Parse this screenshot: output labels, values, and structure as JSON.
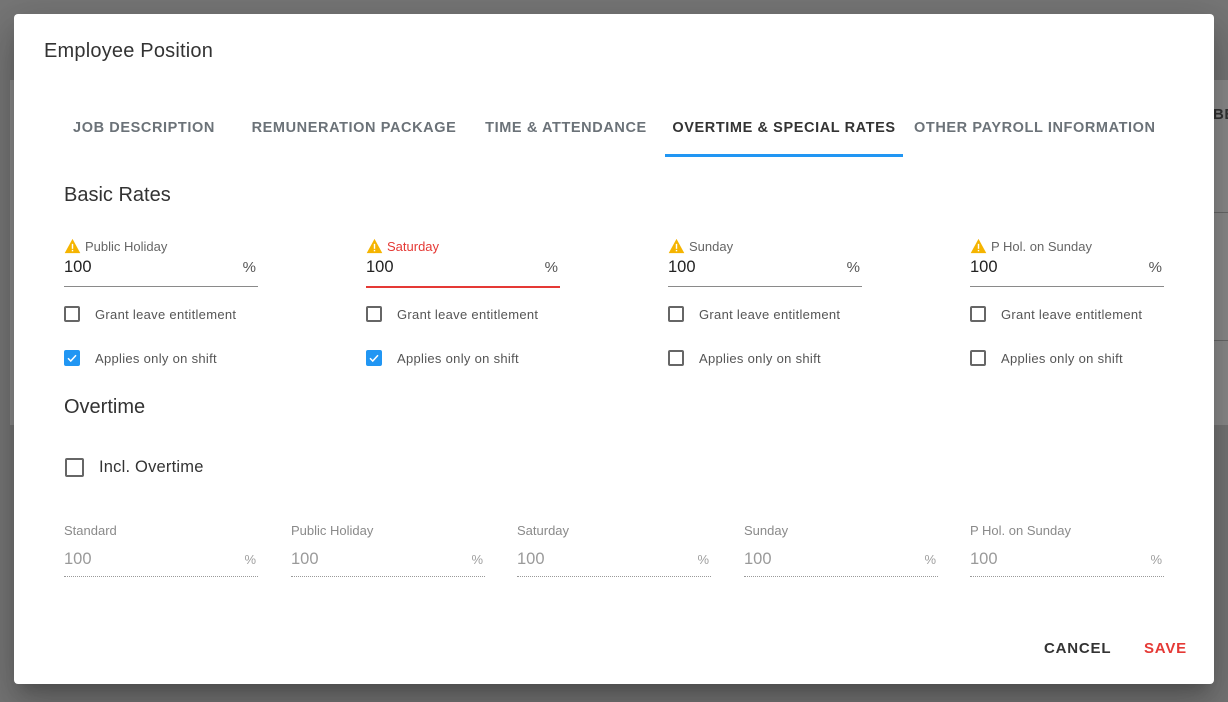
{
  "background": {
    "right_text": "BE"
  },
  "dialog": {
    "title": "Employee Position",
    "tabs": [
      {
        "label": "JOB DESCRIPTION"
      },
      {
        "label": "REMUNERATION PACKAGE"
      },
      {
        "label": "TIME & ATTENDANCE"
      },
      {
        "label": "OVERTIME & SPECIAL RATES",
        "active": true
      },
      {
        "label": "OTHER PAYROLL INFORMATION"
      }
    ],
    "basic_rates": {
      "title": "Basic Rates",
      "fields": [
        {
          "label": "Public Holiday",
          "value": "100",
          "suffix": "%",
          "warning": true,
          "error": false,
          "grant_leave": false,
          "applies_only_on_shift": true
        },
        {
          "label": "Saturday",
          "value": "100",
          "suffix": "%",
          "warning": true,
          "error": true,
          "grant_leave": false,
          "applies_only_on_shift": true
        },
        {
          "label": "Sunday",
          "value": "100",
          "suffix": "%",
          "warning": true,
          "error": false,
          "grant_leave": false,
          "applies_only_on_shift": false
        },
        {
          "label": "P Hol. on Sunday",
          "value": "100",
          "suffix": "%",
          "warning": true,
          "error": false,
          "grant_leave": false,
          "applies_only_on_shift": false
        }
      ],
      "grant_leave_label": "Grant leave entitlement",
      "applies_only_on_shift_label": "Applies only on shift"
    },
    "overtime": {
      "title": "Overtime",
      "incl_overtime_label": "Incl. Overtime",
      "incl_overtime_checked": false,
      "fields": [
        {
          "label": "Standard",
          "value": "100",
          "suffix": "%"
        },
        {
          "label": "Public Holiday",
          "value": "100",
          "suffix": "%"
        },
        {
          "label": "Saturday",
          "value": "100",
          "suffix": "%"
        },
        {
          "label": "Sunday",
          "value": "100",
          "suffix": "%"
        },
        {
          "label": "P Hol. on Sunday",
          "value": "100",
          "suffix": "%"
        }
      ]
    },
    "actions": {
      "cancel_label": "CANCEL",
      "save_label": "SAVE"
    }
  },
  "colors": {
    "accent": "#2196f3",
    "error": "#e53935",
    "warning": "#f5b400"
  }
}
